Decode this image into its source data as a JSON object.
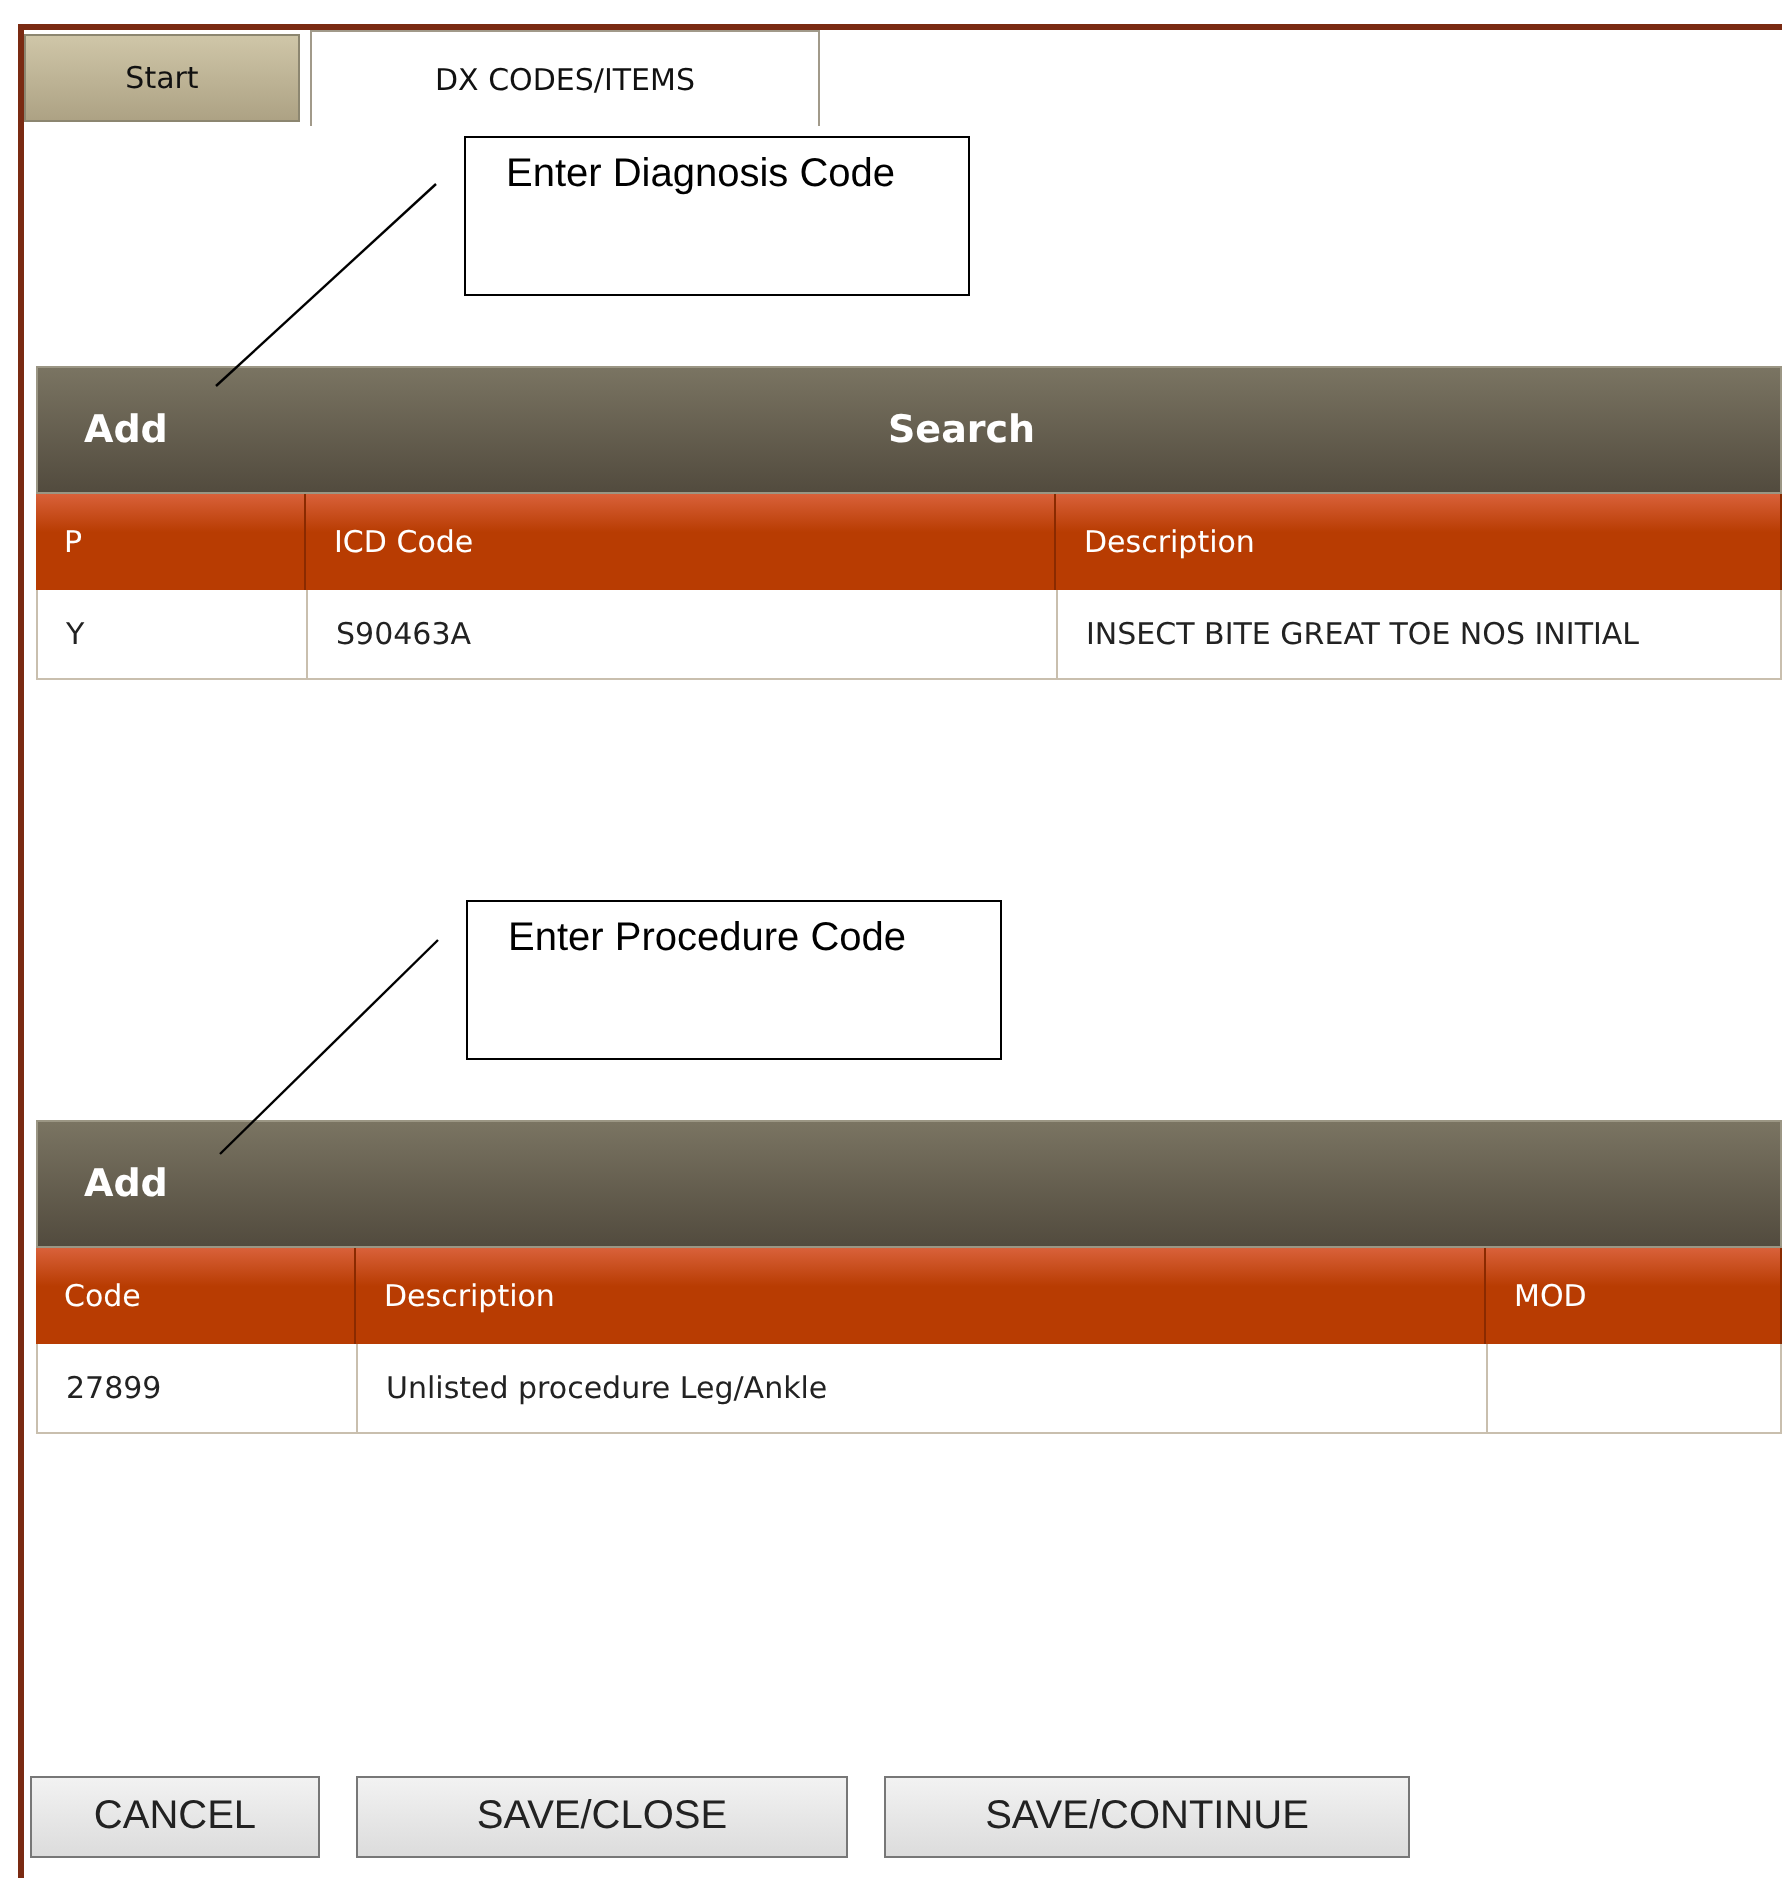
{
  "tabs": [
    {
      "label": "Start",
      "selected": false
    },
    {
      "label": "DX CODES/ITEMS",
      "selected": true
    }
  ],
  "diagnosis": {
    "callout": "Enter Diagnosis Code",
    "add": "Add",
    "search": "Search",
    "columns": [
      "P",
      "ICD Code",
      "Description"
    ],
    "rows": [
      [
        "Y",
        "S90463A",
        "INSECT BITE GREAT TOE NOS INITIAL"
      ]
    ]
  },
  "procedures": {
    "callout": "Enter Procedure Code",
    "add": "Add",
    "columns": [
      "Code",
      "Description",
      "MOD"
    ],
    "rows": [
      [
        "27899",
        "Unlisted procedure Leg/Ankle"
      ]
    ]
  },
  "buttons": [
    "CANCEL",
    "SAVE/CLOSE",
    "SAVE/CONTINUE"
  ]
}
